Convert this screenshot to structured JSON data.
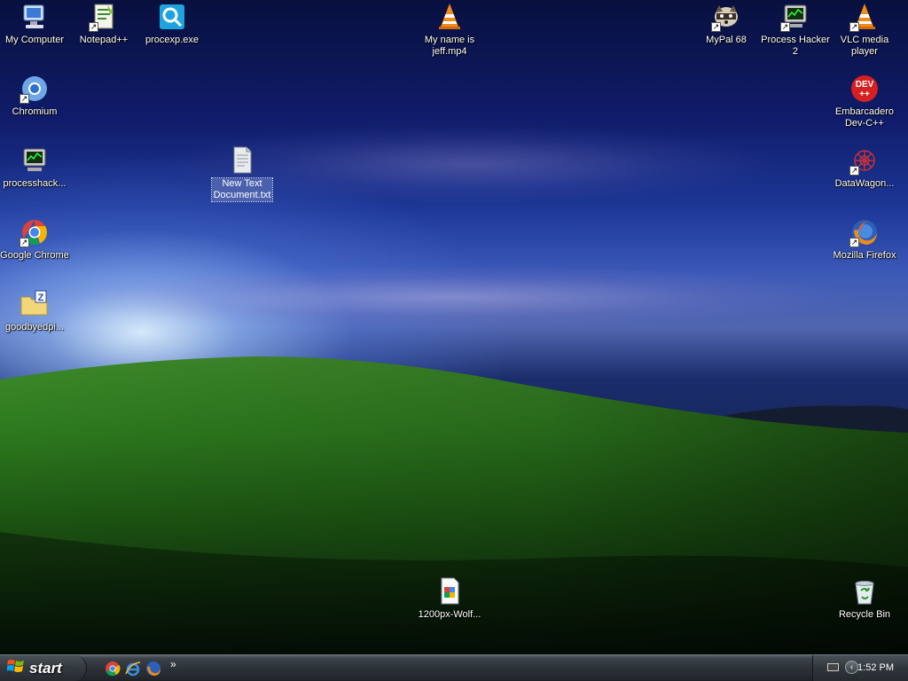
{
  "desktop": {
    "icons": [
      {
        "id": "my-computer",
        "label": "My Computer",
        "selected": false
      },
      {
        "id": "notepadpp",
        "label": "Notepad++",
        "selected": false
      },
      {
        "id": "procexp",
        "label": "procexp.exe",
        "selected": false
      },
      {
        "id": "my-name-is-jeff",
        "label": "My name is\njeff.mp4",
        "selected": false
      },
      {
        "id": "mypal",
        "label": "MyPal 68",
        "selected": false
      },
      {
        "id": "process-hacker-2",
        "label": "Process Hacker\n2",
        "selected": false
      },
      {
        "id": "vlc",
        "label": "VLC media\nplayer",
        "selected": false
      },
      {
        "id": "chromium",
        "label": "Chromium",
        "selected": false
      },
      {
        "id": "embarcadero",
        "label": "Embarcadero\nDev-C++",
        "selected": false
      },
      {
        "id": "processhacker",
        "label": "processhack...",
        "selected": false
      },
      {
        "id": "new-text-doc",
        "label": "New Text\nDocument.txt",
        "selected": true
      },
      {
        "id": "datawagon",
        "label": "DataWagon...",
        "selected": false
      },
      {
        "id": "google-chrome",
        "label": "Google Chrome",
        "selected": false
      },
      {
        "id": "firefox",
        "label": "Mozilla Firefox",
        "selected": false
      },
      {
        "id": "goodbyedpi",
        "label": "goodbyedpi...",
        "selected": false
      },
      {
        "id": "wolf-image",
        "label": "1200px-Wolf...",
        "selected": false
      },
      {
        "id": "recycle-bin",
        "label": "Recycle Bin",
        "selected": false
      }
    ]
  },
  "taskbar": {
    "start_label": "start",
    "quick_launch": [
      "chrome-icon",
      "internet-explorer-icon",
      "firefox-icon"
    ],
    "overflow_label": "»",
    "tray": {
      "clock": "1:52 PM",
      "icons": [
        "keyboard-icon",
        "show-hidden-icons-icon"
      ]
    }
  },
  "colors": {
    "taskbar_dark": "#2c3238",
    "vlc_orange": "#f08a1c",
    "chrome_red": "#db4437",
    "chrome_green": "#0f9d58",
    "chrome_yellow": "#f4b400",
    "chrome_blue": "#4285f4"
  }
}
